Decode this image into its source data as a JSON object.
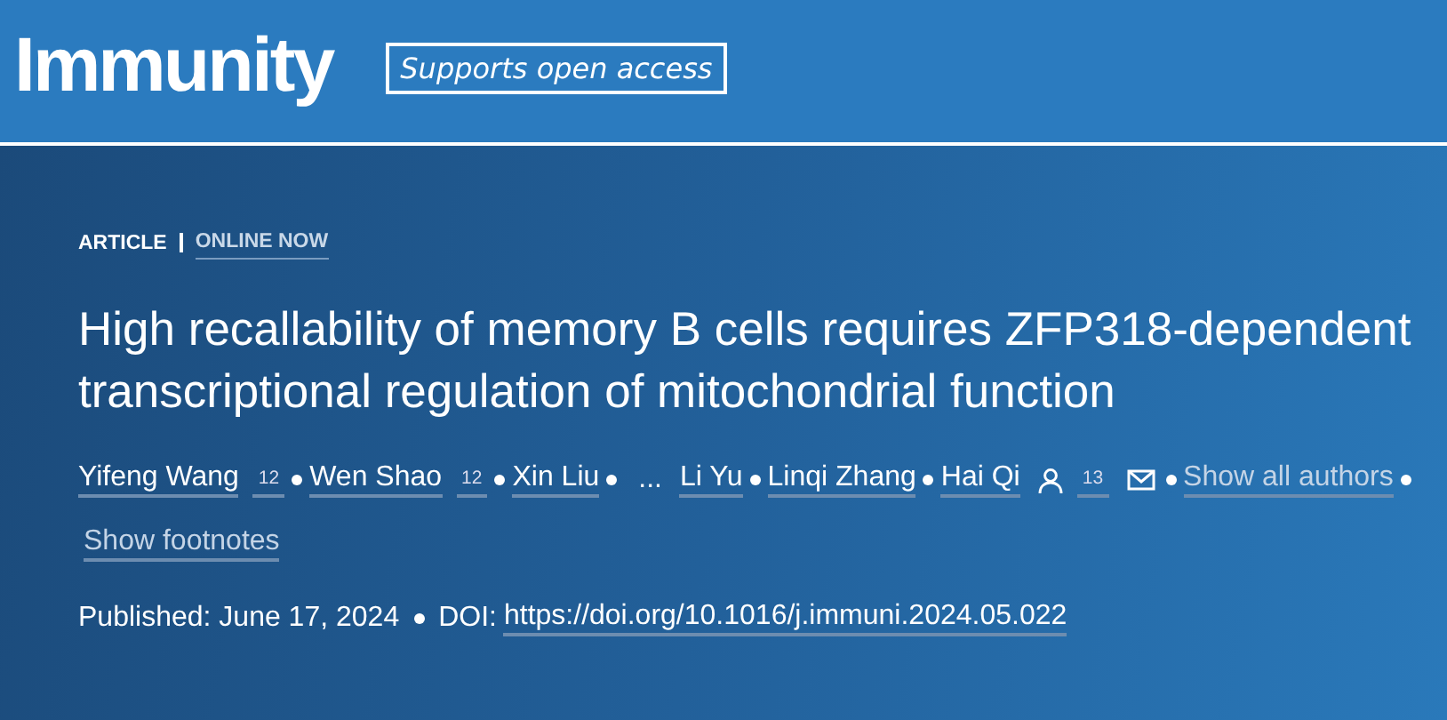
{
  "journal": {
    "name": "Immunity",
    "badge": "Supports open access"
  },
  "article": {
    "type": "ARTICLE",
    "status": "ONLINE NOW",
    "title": "High recallability of memory B cells requires ZFP318-dependent transcriptional regulation of mitochondrial function",
    "authors": [
      {
        "kind": "author",
        "name": "Yifeng Wang",
        "affiliations": "12",
        "corresponding": false
      },
      {
        "kind": "author",
        "name": "Wen Shao",
        "affiliations": "12",
        "corresponding": false
      },
      {
        "kind": "author",
        "name": "Xin Liu",
        "corresponding": false
      },
      {
        "kind": "ellipsis",
        "name": "..."
      },
      {
        "kind": "author",
        "name": "Li Yu",
        "corresponding": false
      },
      {
        "kind": "author",
        "name": "Linqi Zhang",
        "corresponding": false
      },
      {
        "kind": "author",
        "name": "Hai Qi",
        "affiliations": "13",
        "corresponding": true
      }
    ],
    "show_all_authors": "Show all authors",
    "show_footnotes": "Show footnotes",
    "published": "Published: June 17, 2024",
    "doi_label": "DOI:",
    "doi": "https://doi.org/10.1016/j.immuni.2024.05.022"
  }
}
